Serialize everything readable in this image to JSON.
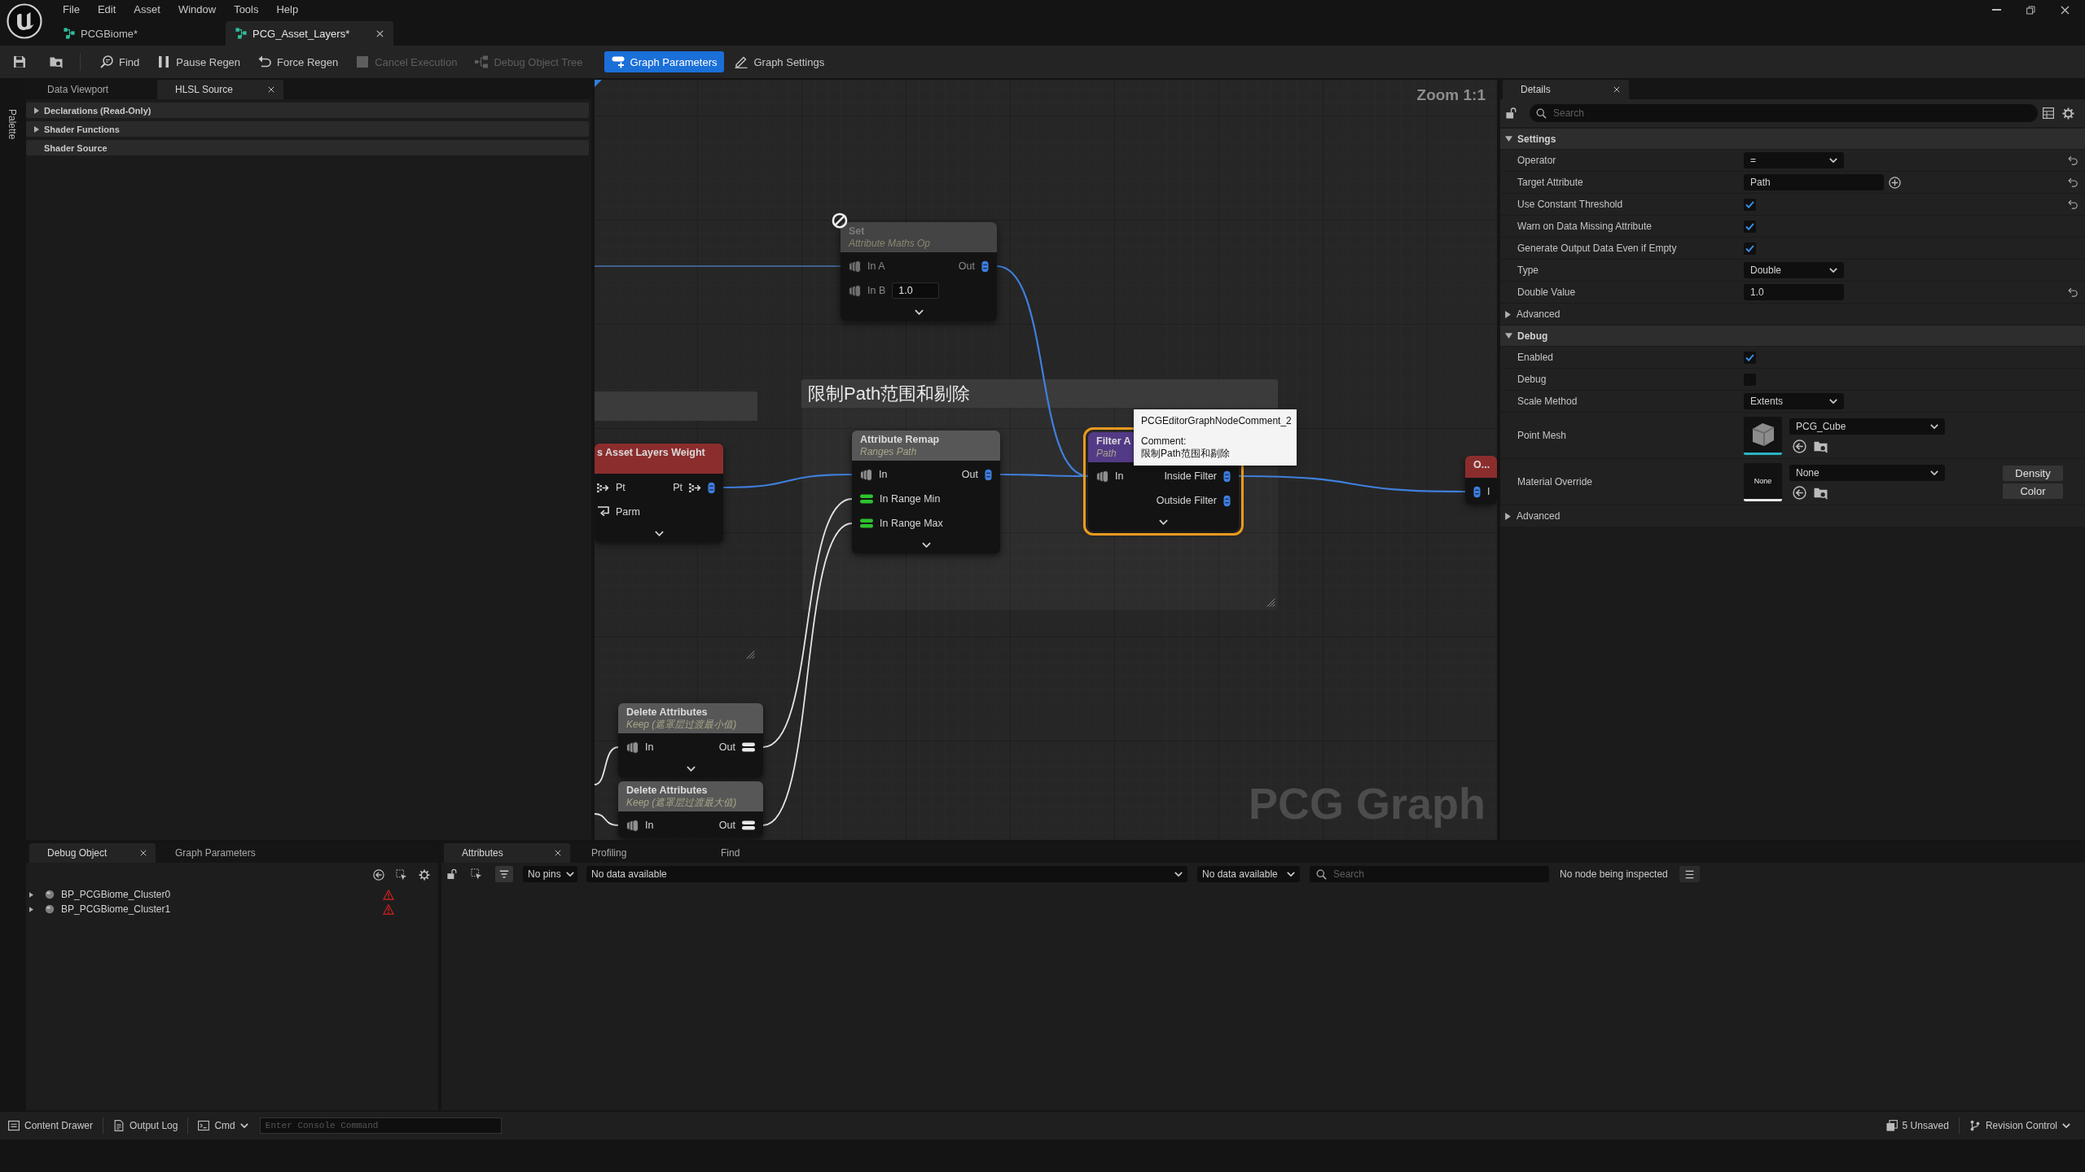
{
  "menu": [
    "File",
    "Edit",
    "Asset",
    "Window",
    "Tools",
    "Help"
  ],
  "document_tabs": [
    {
      "label": "PCGBiome*",
      "selected": false
    },
    {
      "label": "PCG_Asset_Layers*",
      "selected": true
    }
  ],
  "toolbar": [
    {
      "selected": false,
      "disabled": false
    },
    {
      "selected": false,
      "disabled": false
    },
    {
      "label": "Find",
      "selected": false,
      "disabled": false
    },
    {
      "label": "Pause Regen",
      "selected": false,
      "disabled": false
    },
    {
      "label": "Force Regen",
      "selected": false,
      "disabled": false
    },
    {
      "label": "Cancel Execution",
      "selected": false,
      "disabled": true
    },
    {
      "label": "Debug Object Tree",
      "selected": false,
      "disabled": true
    },
    {
      "label": "Graph Parameters",
      "selected": true,
      "disabled": false
    },
    {
      "label": "Graph Settings",
      "selected": false,
      "disabled": false
    }
  ],
  "left_panel": {
    "side_tab": "Palette",
    "tabs": [
      {
        "label": "Data Viewport",
        "selected": false
      },
      {
        "label": "HLSL Source",
        "selected": true
      }
    ],
    "sections": [
      {
        "label": "Declarations (Read-Only)",
        "kind": "group",
        "expanded": false
      },
      {
        "label": "Shader Functions",
        "kind": "group",
        "expanded": false
      },
      {
        "label": "Shader Source",
        "kind": "item"
      }
    ]
  },
  "graph": {
    "zoom": "Zoom 1:1",
    "title": "PCG Graph",
    "comments": [
      {
        "title": "限制Path范围和剔除"
      }
    ],
    "nodes": [
      {
        "title": "Set",
        "subtitle": "Attribute Maths Op",
        "color": "#444444",
        "selected": false,
        "disabled": true,
        "more_pins": true,
        "inputs": [
          {
            "label": "In A",
            "kind": "stack",
            "color": "#6f6f6f"
          },
          {
            "label": "In B",
            "kind": "stack",
            "color": "#6f6f6f",
            "value": "1.0"
          }
        ],
        "outputs": [
          {
            "label": "Out",
            "kind": "capsule",
            "color": "#3d7ee0"
          }
        ]
      },
      {
        "title": "s Asset Layers Weight",
        "color": "#8c2d2d",
        "selected": false,
        "disabled": false,
        "more_pins": true,
        "inputs": [
          {
            "label": "Pt",
            "kind": "grid"
          },
          {
            "label": "Parm",
            "kind": "link"
          }
        ],
        "outputs": [
          {
            "label": "Pt",
            "kind": "grid",
            "color": "#3d7ee0"
          }
        ]
      },
      {
        "title": "Attribute Remap",
        "subtitle": "Ranges Path",
        "color": "#575757",
        "selected": false,
        "disabled": false,
        "more_pins": true,
        "inputs": [
          {
            "label": "In",
            "kind": "stack",
            "color": "#8f8f8f"
          },
          {
            "label": "In Range Min",
            "kind": "bars",
            "color": "#2ec22e"
          },
          {
            "label": "In Range Max",
            "kind": "bars",
            "color": "#2ec22e"
          }
        ],
        "outputs": [
          {
            "label": "Out",
            "kind": "capsule",
            "color": "#3d7ee0"
          }
        ]
      },
      {
        "title": "Filter A",
        "subtitle": "Path",
        "color": "#533a86",
        "selected": true,
        "disabled": false,
        "more_pins": true,
        "inputs": [
          {
            "label": "In",
            "kind": "stack",
            "color": "#8f8f8f"
          }
        ],
        "outputs": [
          {
            "label": "Inside Filter",
            "kind": "capsule",
            "color": "#3d7ee0"
          },
          {
            "label": "Outside Filter",
            "kind": "capsule",
            "color": "#3d7ee0"
          }
        ]
      },
      {
        "title": "O...",
        "color": "#8c2d2d",
        "selected": false,
        "disabled": false,
        "more_pins": false,
        "inputs": [
          {
            "label": "I",
            "kind": "capsule",
            "color": "#3d7ee0"
          }
        ]
      },
      {
        "title": "Delete Attributes",
        "subtitle": "Keep (遮罩层过渡最小值)",
        "color": "#575757",
        "selected": false,
        "disabled": false,
        "more_pins": true,
        "inputs": [
          {
            "label": "In",
            "kind": "stack",
            "color": "#8f8f8f"
          }
        ],
        "outputs": [
          {
            "label": "Out",
            "kind": "bars",
            "color": "#e8e8e8"
          }
        ]
      },
      {
        "title": "Delete Attributes",
        "subtitle": "Keep (遮罩层过渡最大值)",
        "color": "#575757",
        "selected": false,
        "disabled": false,
        "more_pins": false,
        "inputs": [
          {
            "label": "In",
            "kind": "stack",
            "color": "#8f8f8f"
          }
        ],
        "outputs": [
          {
            "label": "Out",
            "kind": "bars",
            "color": "#e8e8e8"
          }
        ]
      }
    ],
    "tooltip": {
      "title": "PCGEditorGraphNodeComment_2",
      "label": "Comment:",
      "text": "限制Path范围和剔除"
    }
  },
  "details": {
    "tab": {
      "label": "Details",
      "selected": true
    },
    "search": {
      "placeholder": "Search"
    },
    "sections": [
      {
        "title": "Settings",
        "expanded": true,
        "rows": [
          {
            "label": "Operator",
            "kind": "dropdown",
            "value": "=",
            "modified": true
          },
          {
            "label": "Target Attribute",
            "kind": "attribute",
            "value": "Path",
            "modified": true
          },
          {
            "label": "Use Constant Threshold",
            "kind": "checkbox",
            "checked": true,
            "modified": true
          },
          {
            "label": "Warn on Data Missing Attribute",
            "kind": "checkbox",
            "checked": true,
            "modified": false
          },
          {
            "label": "Generate Output Data Even if Empty",
            "kind": "checkbox",
            "checked": true,
            "modified": false
          },
          {
            "label": "Type",
            "kind": "dropdown",
            "value": "Double",
            "modified": false
          },
          {
            "label": "Double Value",
            "kind": "number",
            "value": "1.0",
            "modified": true
          },
          {
            "label": "Advanced",
            "kind": "group",
            "expanded": false
          }
        ]
      },
      {
        "title": "Debug",
        "expanded": true,
        "rows": [
          {
            "label": "Enabled",
            "kind": "checkbox",
            "checked": true,
            "modified": false
          },
          {
            "label": "Debug",
            "kind": "checkbox",
            "checked": false,
            "modified": false
          },
          {
            "label": "Scale Method",
            "kind": "dropdown",
            "value": "Extents",
            "modified": false
          },
          {
            "label": "Point Mesh",
            "kind": "asset",
            "value": "PCG_Cube",
            "modified": false
          },
          {
            "label": "Material Override",
            "kind": "asset",
            "value": "None",
            "thumbnail_label": "None",
            "buttons": [
              "Density",
              "Color"
            ],
            "modified": false
          },
          {
            "label": "Advanced",
            "kind": "group",
            "expanded": false
          }
        ]
      }
    ]
  },
  "debug_panel": {
    "tabs": [
      {
        "label": "Debug Object",
        "selected": true
      },
      {
        "label": "Graph Parameters",
        "selected": false
      }
    ],
    "items": [
      {
        "label": "BP_PCGBiome_Cluster0",
        "expanded": false,
        "warning": true
      },
      {
        "label": "BP_PCGBiome_Cluster1",
        "expanded": false,
        "warning": true
      }
    ]
  },
  "attributes_panel": {
    "tabs": [
      {
        "label": "Attributes",
        "selected": true
      },
      {
        "label": "Profiling",
        "selected": false
      },
      {
        "label": "Find",
        "selected": false
      }
    ],
    "pins": "No pins",
    "data": "No data available",
    "data_2": "No data available",
    "search": {
      "placeholder": "Search"
    },
    "status": "No node being inspected"
  },
  "status_bar": {
    "left": [
      {
        "label": "Content Drawer",
        "kind": "button"
      },
      {
        "label": "Output Log",
        "kind": "button"
      },
      {
        "label": "Cmd",
        "kind": "dropdown"
      }
    ],
    "console": {
      "placeholder": "Enter Console Command"
    },
    "right": [
      {
        "label": "5 Unsaved",
        "kind": "button"
      },
      {
        "label": "Revision Control",
        "kind": "dropdown"
      }
    ]
  }
}
